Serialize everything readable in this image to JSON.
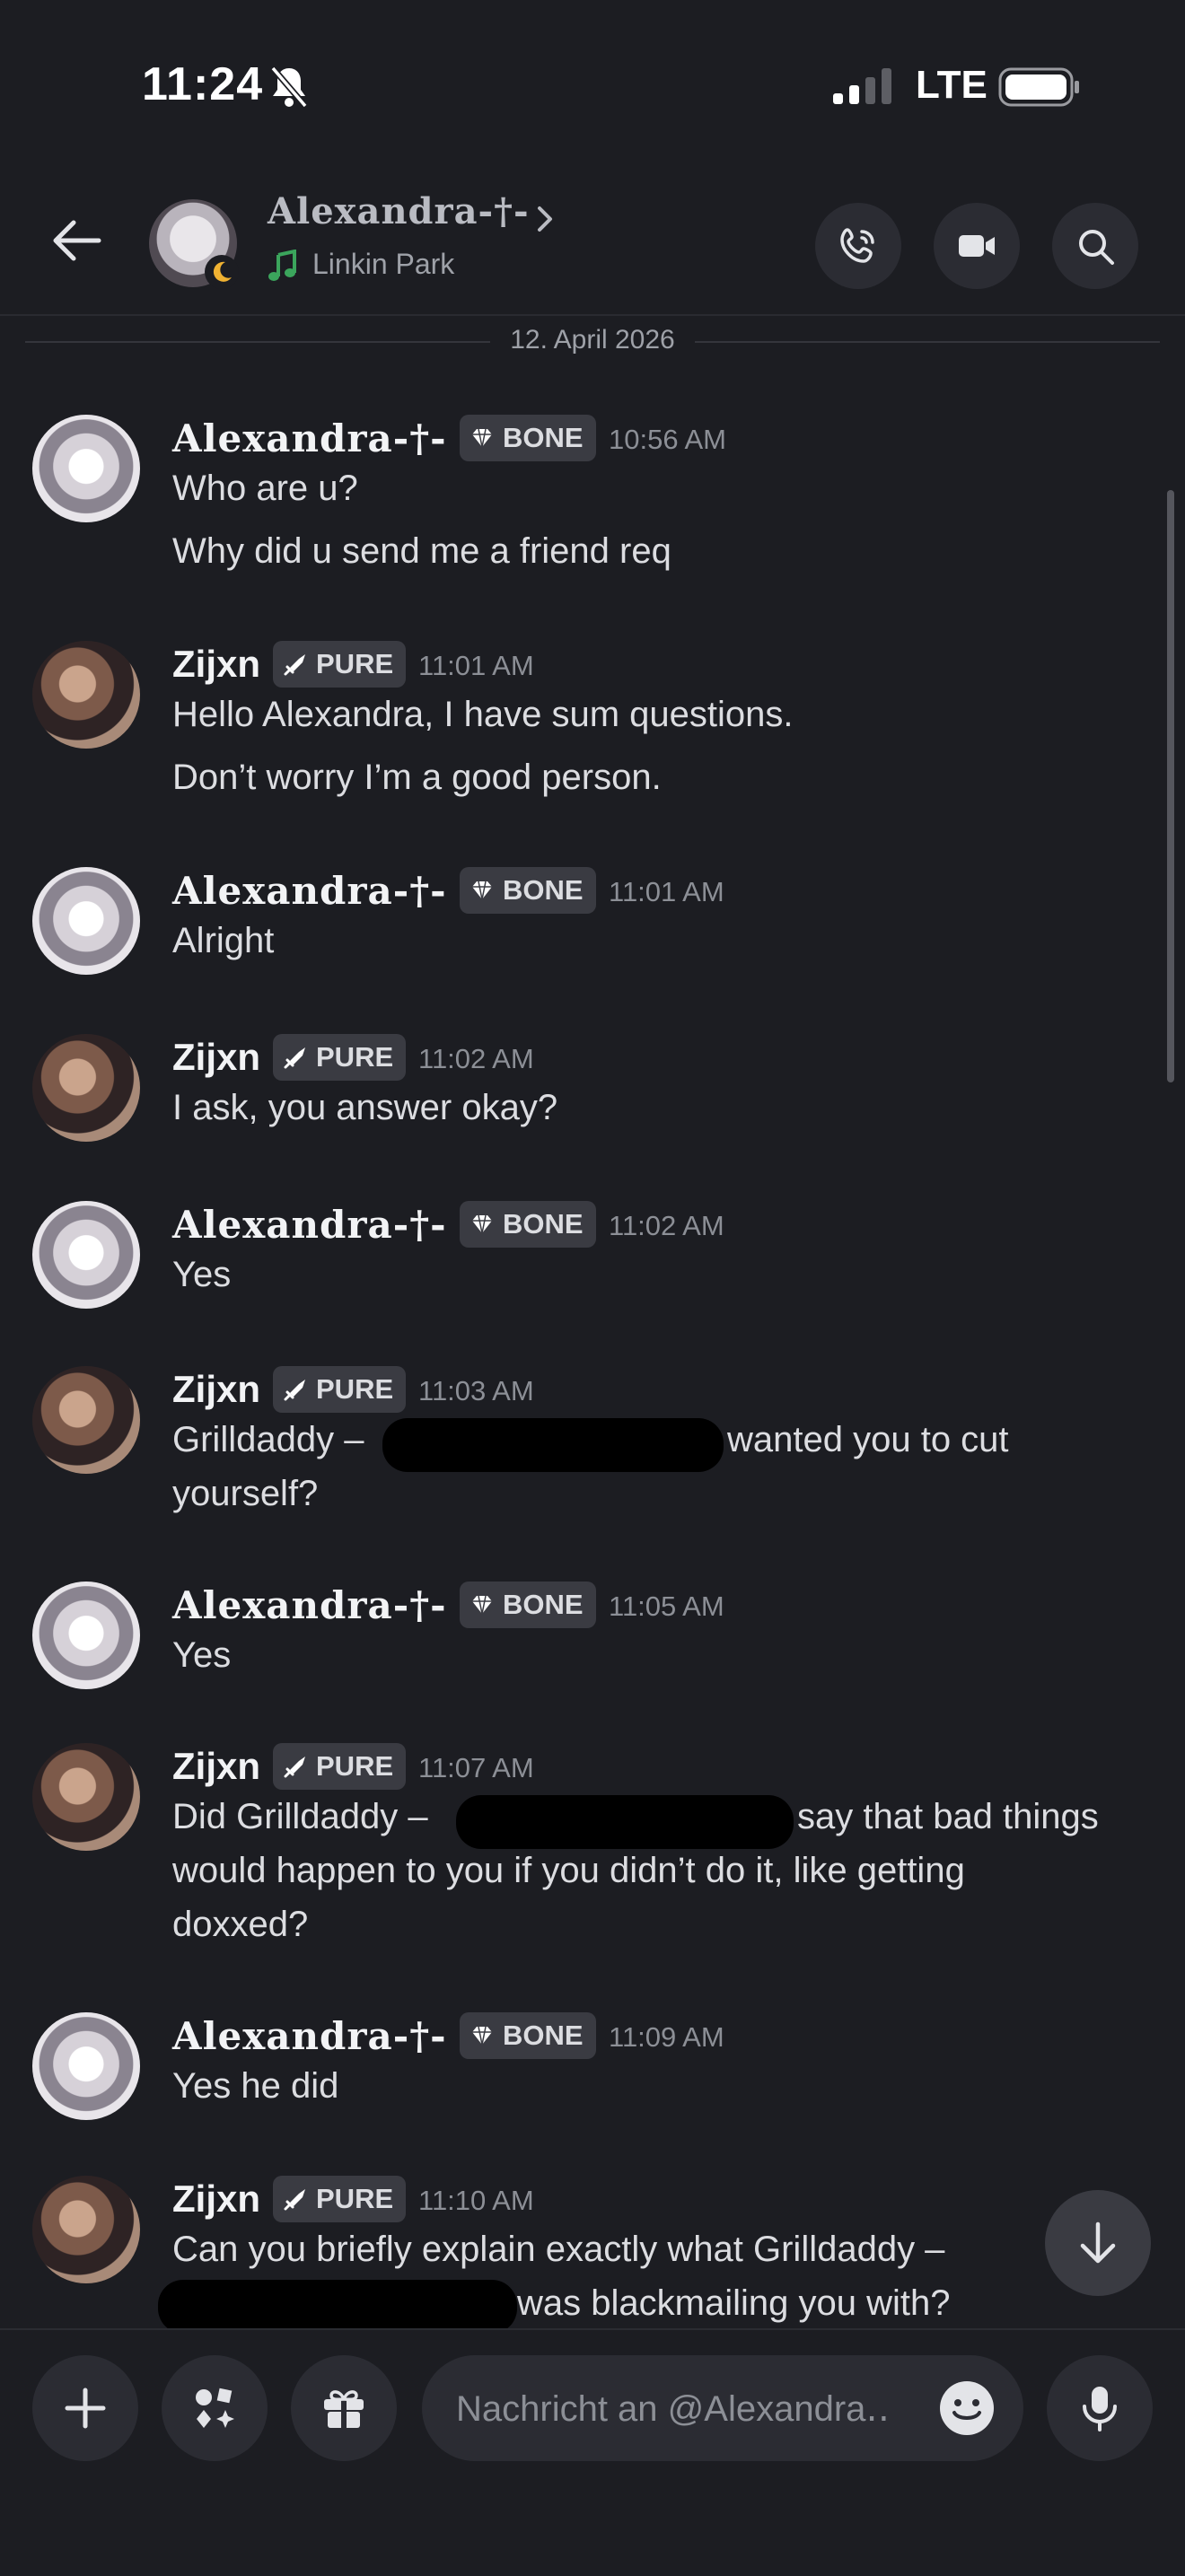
{
  "status_bar": {
    "time": "11:24",
    "network": "LTE"
  },
  "header": {
    "name": "Alexandra-†-",
    "status": "Linkin Park",
    "buttons": [
      "voice-call",
      "video-call",
      "search"
    ]
  },
  "date_divider": "12. April 2026",
  "messages": [
    {
      "author": "Alexandra-†-",
      "badge": "BONE",
      "time": "10:56 AM",
      "lines": [
        "Who are u?",
        "Why did u send me a friend req"
      ]
    },
    {
      "author": "Zijxn",
      "badge": "PURE",
      "time": "11:01 AM",
      "lines": [
        "Hello Alexandra, I have sum questions.",
        "Don’t worry I’m a good person."
      ]
    },
    {
      "author": "Alexandra-†-",
      "badge": "BONE",
      "time": "11:01 AM",
      "lines": [
        "Alright"
      ]
    },
    {
      "author": "Zijxn",
      "badge": "PURE",
      "time": "11:02 AM",
      "lines": [
        "I ask, you answer okay?"
      ]
    },
    {
      "author": "Alexandra-†-",
      "badge": "BONE",
      "time": "11:02 AM",
      "lines": [
        "Yes"
      ]
    },
    {
      "author": "Zijxn",
      "badge": "PURE",
      "time": "11:03 AM",
      "lines": [
        "Grilldaddy –",
        "wanted you to cut",
        "yourself?"
      ]
    },
    {
      "author": "Alexandra-†-",
      "badge": "BONE",
      "time": "11:05 AM",
      "lines": [
        "Yes"
      ]
    },
    {
      "author": "Zijxn",
      "badge": "PURE",
      "time": "11:07 AM",
      "lines": [
        "Did Grilldaddy –",
        "say that bad things",
        "would happen to you if you didn’t do it, like getting",
        "doxxed?"
      ]
    },
    {
      "author": "Alexandra-†-",
      "badge": "BONE",
      "time": "11:09 AM",
      "lines": [
        "Yes he did"
      ]
    },
    {
      "author": "Zijxn",
      "badge": "PURE",
      "time": "11:10 AM",
      "lines": [
        "Can you briefly explain exactly what Grilldaddy –",
        "was blackmailing you with?"
      ]
    }
  ],
  "composer": {
    "placeholder": "Nachricht an @Alexandra‥"
  },
  "colors": {
    "background": "#1c1d22",
    "badge_bg": "#3a3b42",
    "status_green": "#3ba55c",
    "moon": "#f0b232"
  }
}
